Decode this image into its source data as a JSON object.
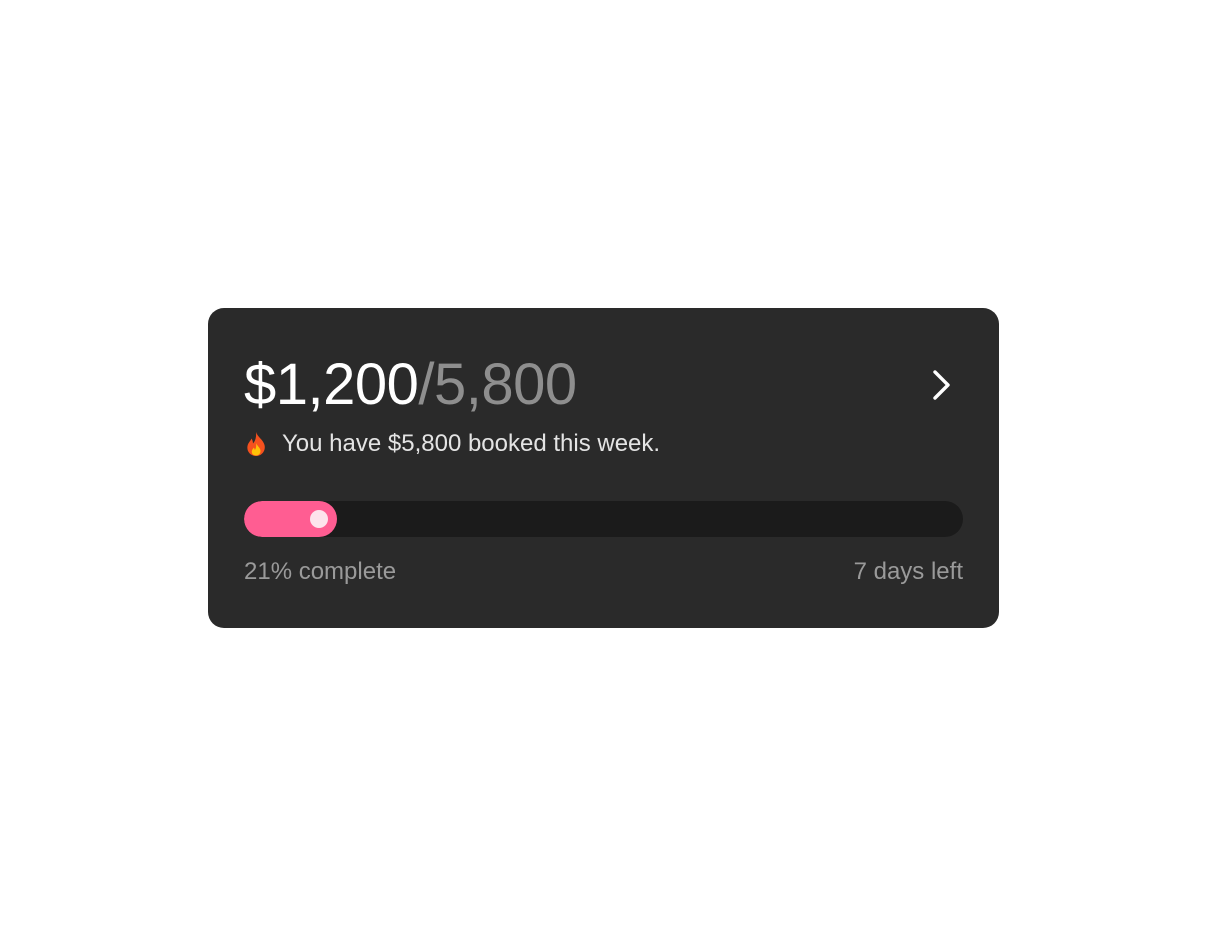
{
  "card": {
    "amount_current": "$1,200",
    "amount_separator": "/",
    "amount_target": "5,800",
    "subtitle": "You have $5,800 booked this week.",
    "subtitle_icon": "fire-icon",
    "navigate_icon": "chevron-right-icon",
    "progress_fraction": 0.21,
    "progress_label": "21% complete",
    "time_left_label": "7 days left",
    "colors": {
      "card_background": "#2a2a2a",
      "track": "#1b1b1b",
      "fill": "#ff5d92",
      "knob": "#fde3ec",
      "primary_text": "#ffffff",
      "muted_text": "#8e8e8e"
    }
  }
}
